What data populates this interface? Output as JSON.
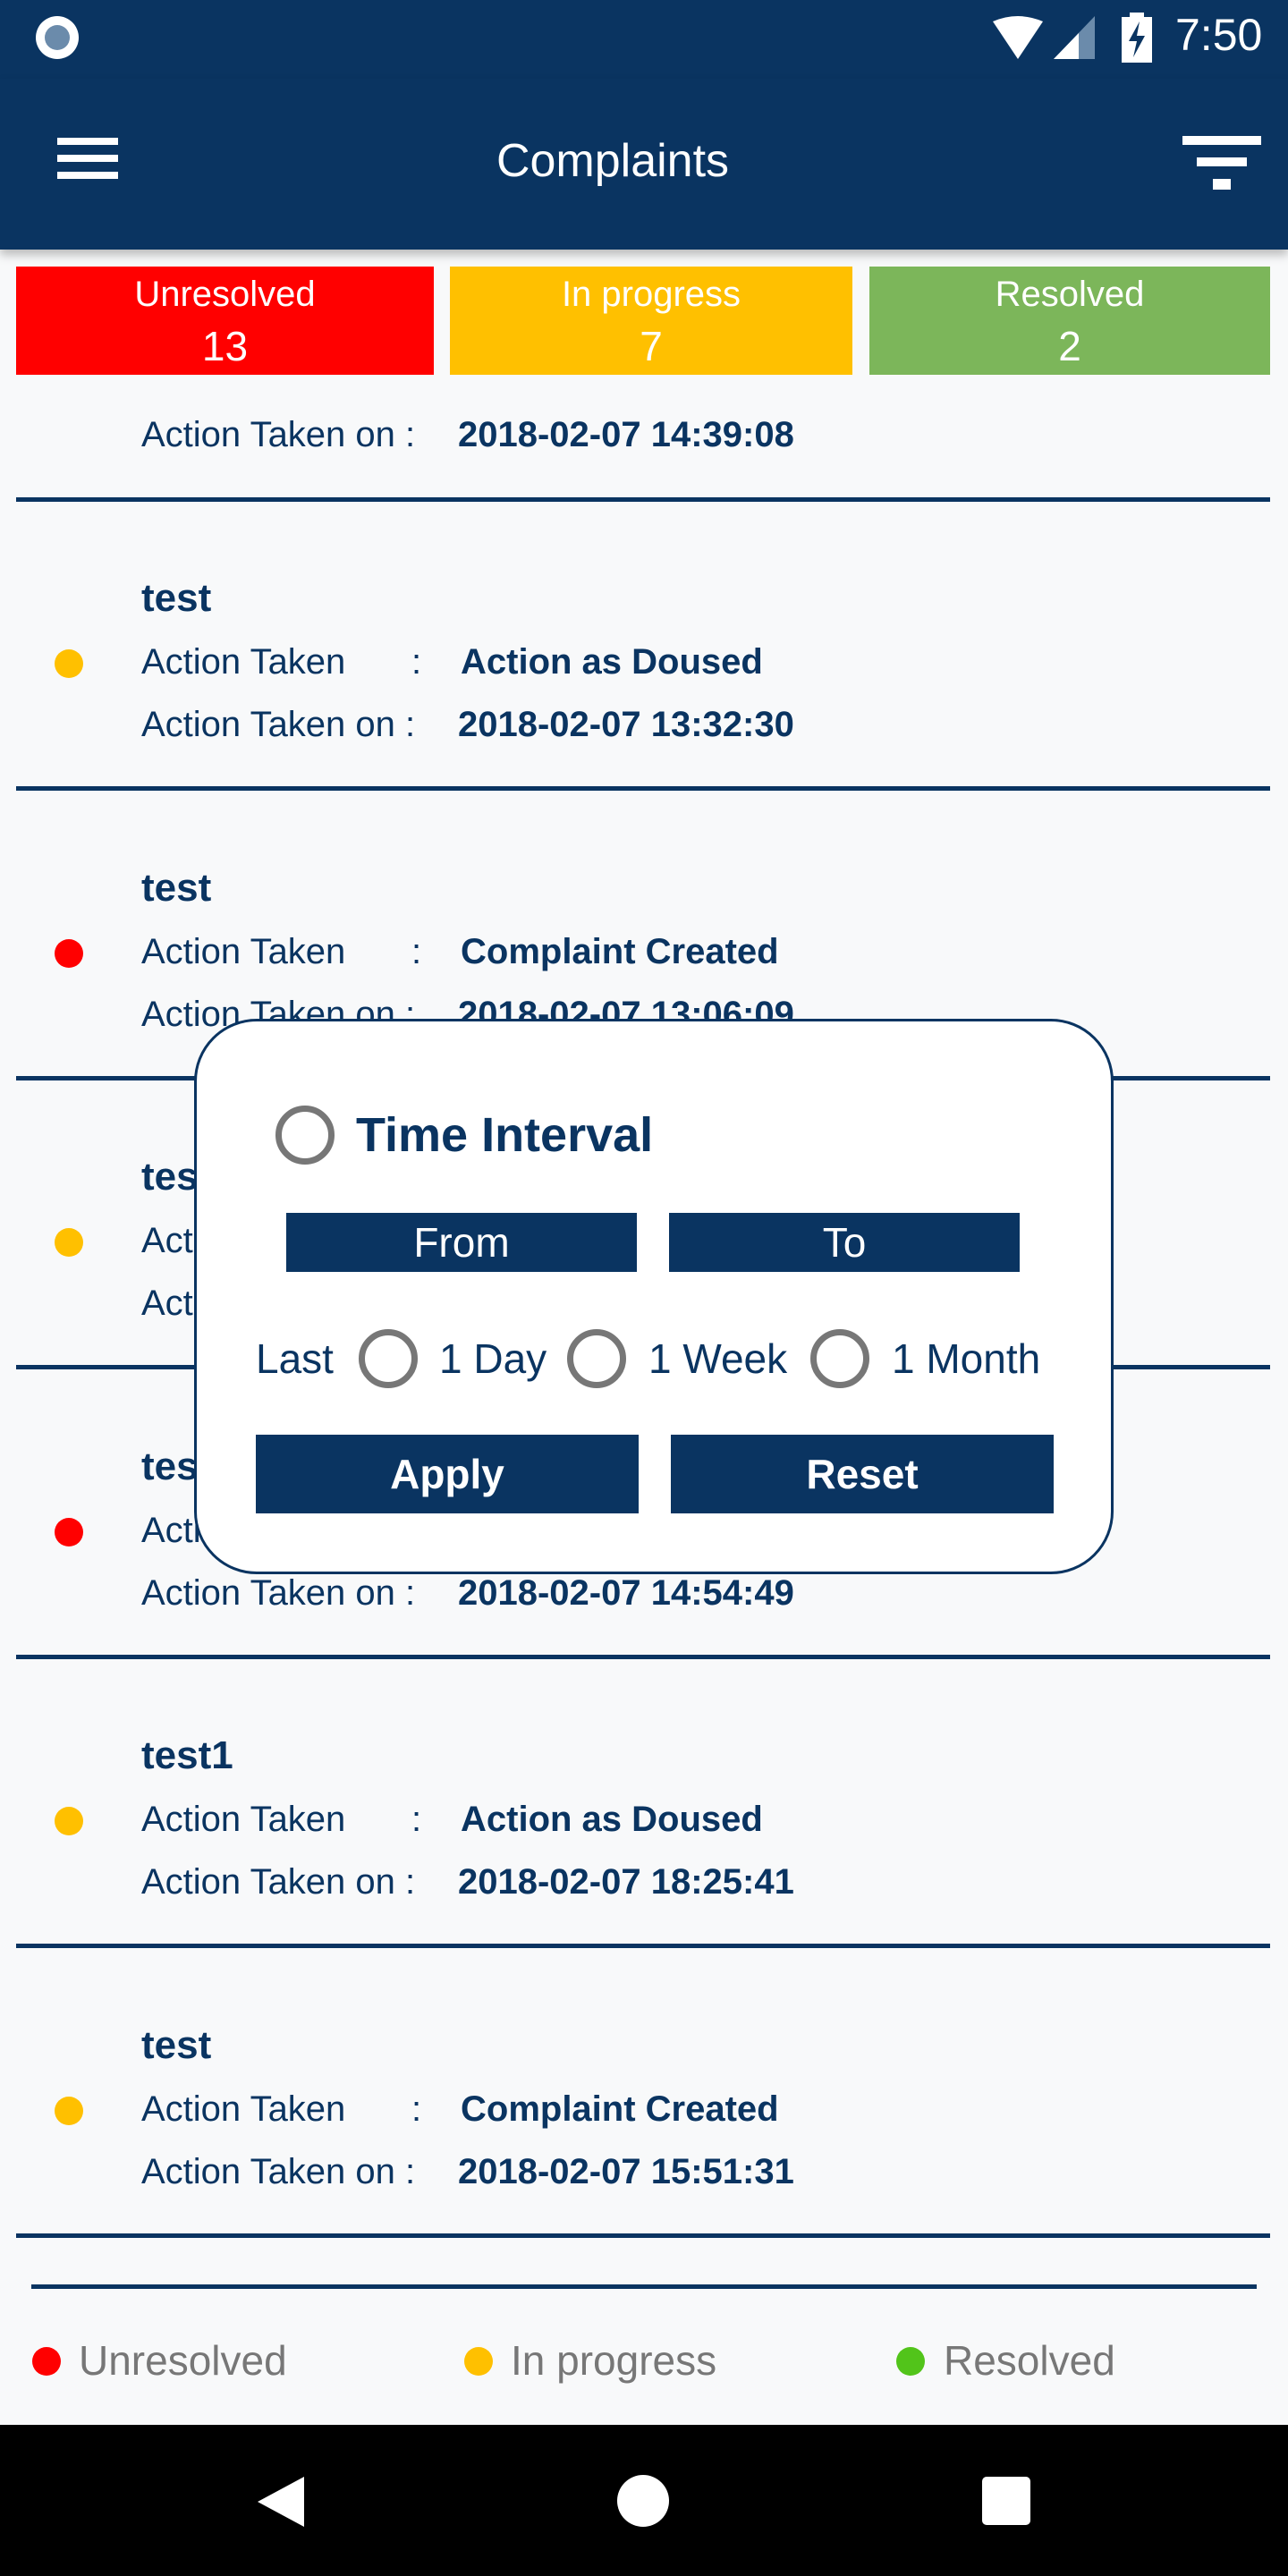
{
  "status_bar": {
    "time": "7:50"
  },
  "header": {
    "title": "Complaints",
    "menu_icon": "hamburger-icon",
    "filter_icon": "filter-icon"
  },
  "summary": [
    {
      "label": "Unresolved",
      "count": "13",
      "color": "#ff0000"
    },
    {
      "label": "In progress",
      "count": "7",
      "color": "#ffc000"
    },
    {
      "label": "Resolved",
      "count": "2",
      "color": "#7cb65a"
    }
  ],
  "list": {
    "action_label": "Action Taken",
    "separator": ":",
    "action_on_label": "Action Taken on :",
    "partial_first_row": {
      "action_on": "2018-02-07 14:39:08"
    },
    "rows": [
      {
        "title": "test",
        "status_color": "#ffc000",
        "action": "Action as Doused",
        "action_on": "2018-02-07 13:32:30"
      },
      {
        "title": "test",
        "status_color": "#ff0000",
        "action": "Complaint Created",
        "action_on": "2018-02-07 13:06:09"
      },
      {
        "title": "tes",
        "status_color": "#ffc000",
        "action": "",
        "action_on": ""
      },
      {
        "title": "tes",
        "status_color": "#ff0000",
        "action": "",
        "action_on": "2018-02-07 14:54:49"
      },
      {
        "title": "test1",
        "status_color": "#ffc000",
        "action": "Action as Doused",
        "action_on": "2018-02-07 18:25:41"
      },
      {
        "title": "test",
        "status_color": "#ffc000",
        "action": "Complaint Created",
        "action_on": "2018-02-07 15:51:31"
      }
    ]
  },
  "filter_popup": {
    "time_interval_label": "Time Interval",
    "from_label": "From",
    "to_label": "To",
    "last_label": "Last",
    "options": [
      "1 Day",
      "1 Week",
      "1 Month"
    ],
    "apply_label": "Apply",
    "reset_label": "Reset"
  },
  "legend": [
    {
      "label": "Unresolved",
      "color": "#ff0000"
    },
    {
      "label": "In progress",
      "color": "#ffc000"
    },
    {
      "label": "Resolved",
      "color": "#52c41a"
    }
  ]
}
